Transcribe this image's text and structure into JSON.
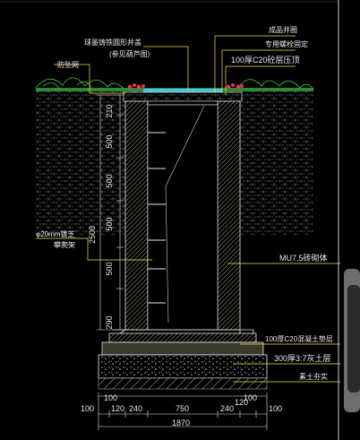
{
  "labels": {
    "cover": "球墨铸铁圆形井盖",
    "cover_note": "(参见葫芦图)",
    "anti_fall_net": "防坠网",
    "finished_ring": "成品井圈",
    "bolt_fix": "专用螺栓固定",
    "pressure_ring": "100厚C20砼层压顶",
    "ladder": "φ20mm镀芝",
    "ladder_2": "攀爬架",
    "masonry": "MU7.5砖砌体",
    "cushion": "100厚C20混凝土垫层",
    "lime_soil": "300厚3:7灰土层",
    "compacted": "素土夯实"
  },
  "vertical_dims": [
    "210",
    "500",
    "500",
    "2500",
    "500",
    "500",
    "290"
  ],
  "bottom_dims": {
    "row1": [
      "100",
      "120",
      "240",
      "750",
      "240",
      "120",
      "100"
    ],
    "row0": [
      "100",
      "100"
    ],
    "total": "1870"
  },
  "colors": {
    "background": "#000000",
    "line": "#e6e6e6",
    "yellow": "#ffe14a",
    "green": "#3fd14a",
    "cyan": "#49c4d9",
    "red": "#e6335a",
    "pink": "#f07ea0",
    "gray_pattern": "#8a8a8a"
  }
}
